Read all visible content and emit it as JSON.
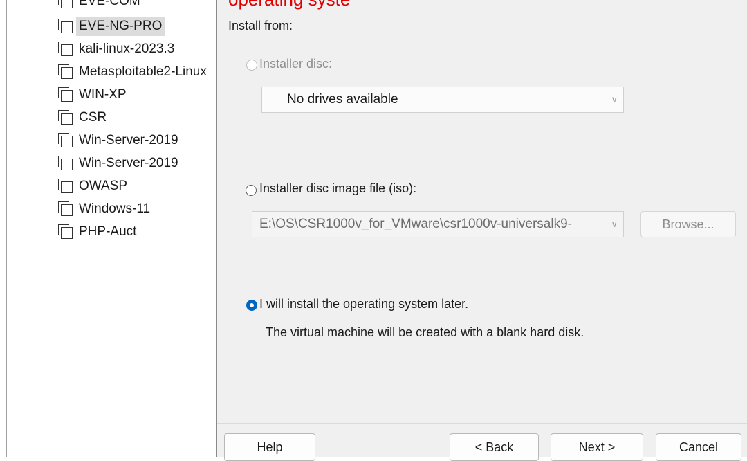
{
  "left_panel": {
    "overlay_text": "EVE-COM",
    "items": [
      {
        "label": "EVE-NG-PRO"
      },
      {
        "label": "kali-linux-2023.3"
      },
      {
        "label": "Metasploitable2-Linux"
      },
      {
        "label": "WIN-XP"
      },
      {
        "label": "CSR"
      },
      {
        "label": "Win-Server-2019"
      },
      {
        "label": "Win-Server-2019"
      },
      {
        "label": "OWASP"
      },
      {
        "label": "Windows-11"
      },
      {
        "label": "PHP-Auct"
      }
    ]
  },
  "annotation": {
    "text": "operating syste"
  },
  "wizard": {
    "install_from_label": "Install from:",
    "installer_disc": {
      "label": "Installer disc:",
      "dropdown_value": "No drives available"
    },
    "iso_option": {
      "label": "Installer disc image file (iso):",
      "path_value": "E:\\OS\\CSR1000v_for_VMware\\csr1000v-universalk9-",
      "browse_label": "Browse..."
    },
    "later_option": {
      "label": "I will install the operating system later.",
      "description": "The virtual machine will be created with a blank hard disk."
    },
    "buttons": {
      "help": "Help",
      "back": "< Back",
      "next": "Next >",
      "cancel": "Cancel"
    }
  }
}
